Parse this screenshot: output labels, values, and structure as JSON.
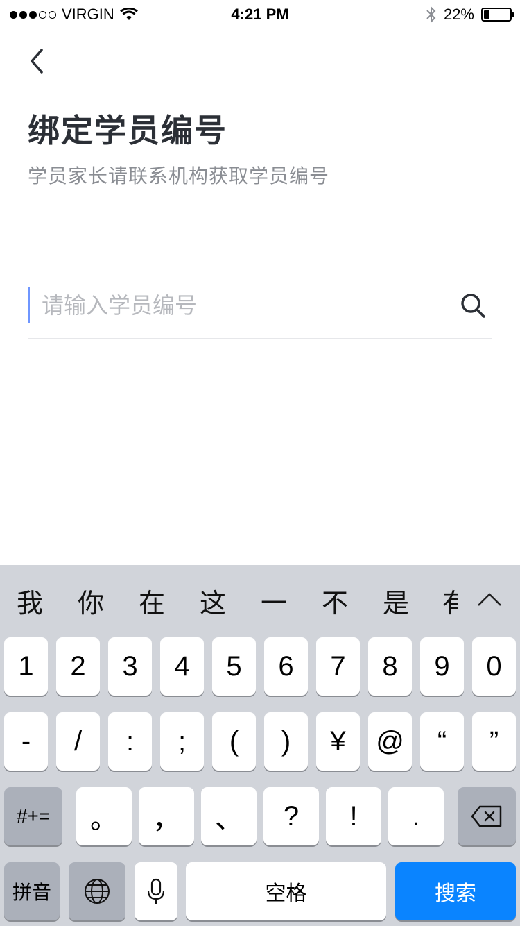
{
  "status_bar": {
    "carrier": "VIRGIN",
    "signal_filled": 3,
    "signal_total": 5,
    "time": "4:21 PM",
    "battery_text": "22%",
    "battery_level": 0.22
  },
  "header": {
    "title": "绑定学员编号",
    "subtitle": "学员家长请联系机构获取学员编号"
  },
  "search": {
    "placeholder": "请输入学员编号",
    "value": ""
  },
  "keyboard": {
    "candidates": [
      "我",
      "你",
      "在",
      "这",
      "一",
      "不",
      "是",
      "有"
    ],
    "row1": [
      "1",
      "2",
      "3",
      "4",
      "5",
      "6",
      "7",
      "8",
      "9",
      "0"
    ],
    "row2": [
      "-",
      "/",
      ":",
      ";",
      "(",
      ")",
      "¥",
      "@",
      "“",
      "”"
    ],
    "symbols_key": "#+=",
    "row3": [
      "。",
      "，",
      "、",
      "?",
      "!",
      "."
    ],
    "pinyin_key": "拼音",
    "space_key": "空格",
    "search_key": "搜索"
  },
  "colors": {
    "accent_caret": "#6f96ff",
    "search_key_bg": "#0a84ff",
    "keyboard_bg": "#d1d4da"
  }
}
